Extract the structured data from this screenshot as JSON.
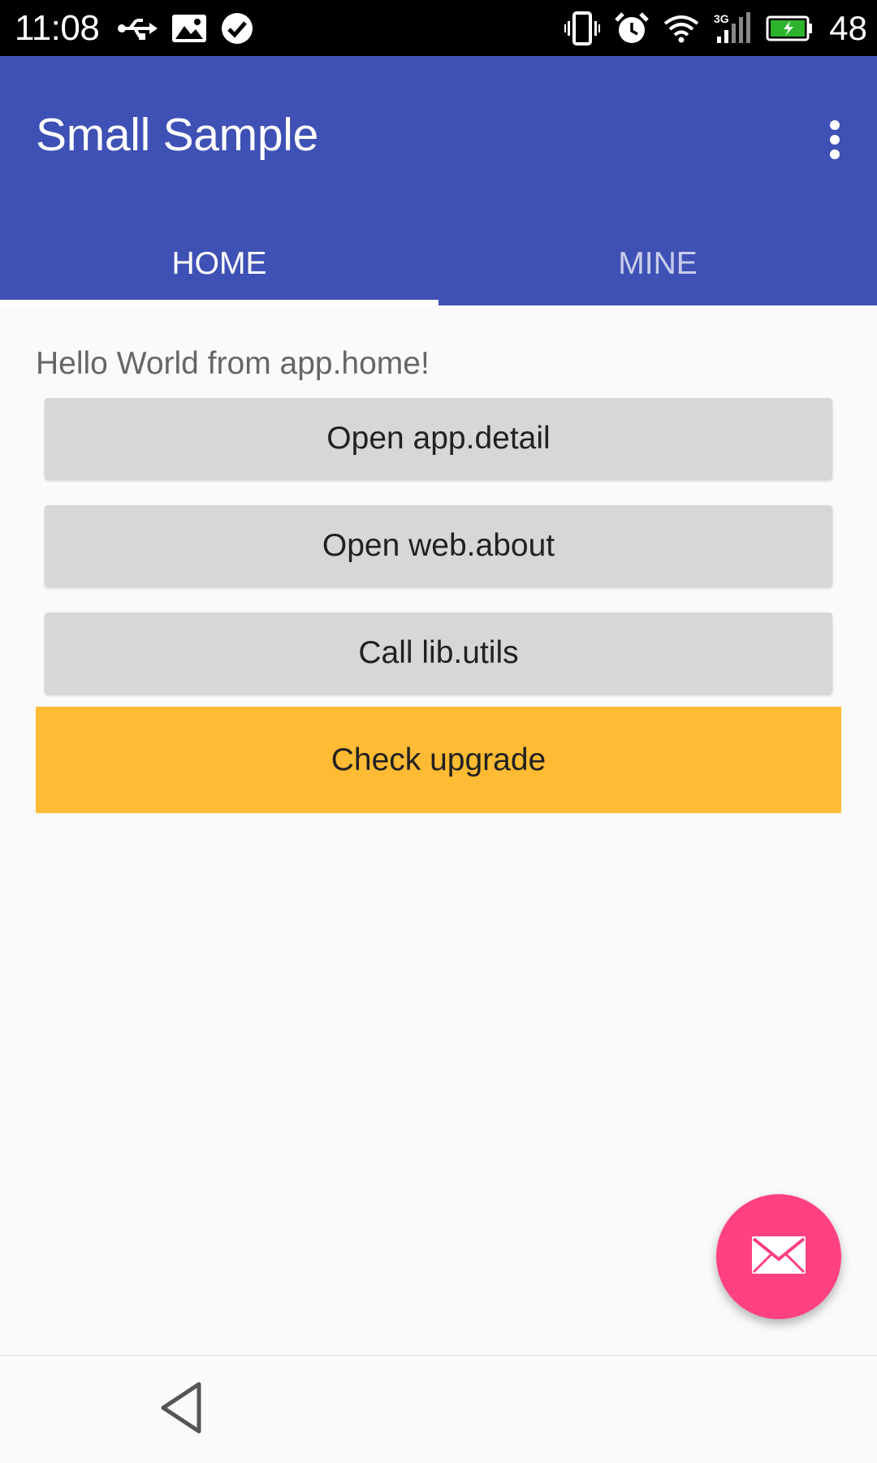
{
  "status_bar": {
    "time": "11:08",
    "left_icons": [
      "usb-icon",
      "image-icon",
      "check-circle-icon"
    ],
    "right_icons": [
      "vibrate-icon",
      "alarm-icon",
      "wifi-icon",
      "signal-3g-icon",
      "battery-charging-icon"
    ],
    "network_type": "3G",
    "battery_level": "48"
  },
  "app_bar": {
    "title": "Small Sample",
    "overflow_icon": "more-vert-icon",
    "color": "#3f51b5"
  },
  "tabs": [
    {
      "label": "HOME",
      "selected": true
    },
    {
      "label": "MINE",
      "selected": false
    }
  ],
  "content": {
    "hello_text": "Hello World from app.home!",
    "buttons": {
      "open_detail": "Open app.detail",
      "open_about": "Open web.about",
      "call_utils": "Call lib.utils",
      "check_upgrade": "Check upgrade"
    },
    "upgrade_color": "#ffbb33"
  },
  "fab": {
    "icon": "mail-icon",
    "color": "#ff4081"
  },
  "nav_bar": {
    "back_icon": "back-triangle-icon"
  }
}
